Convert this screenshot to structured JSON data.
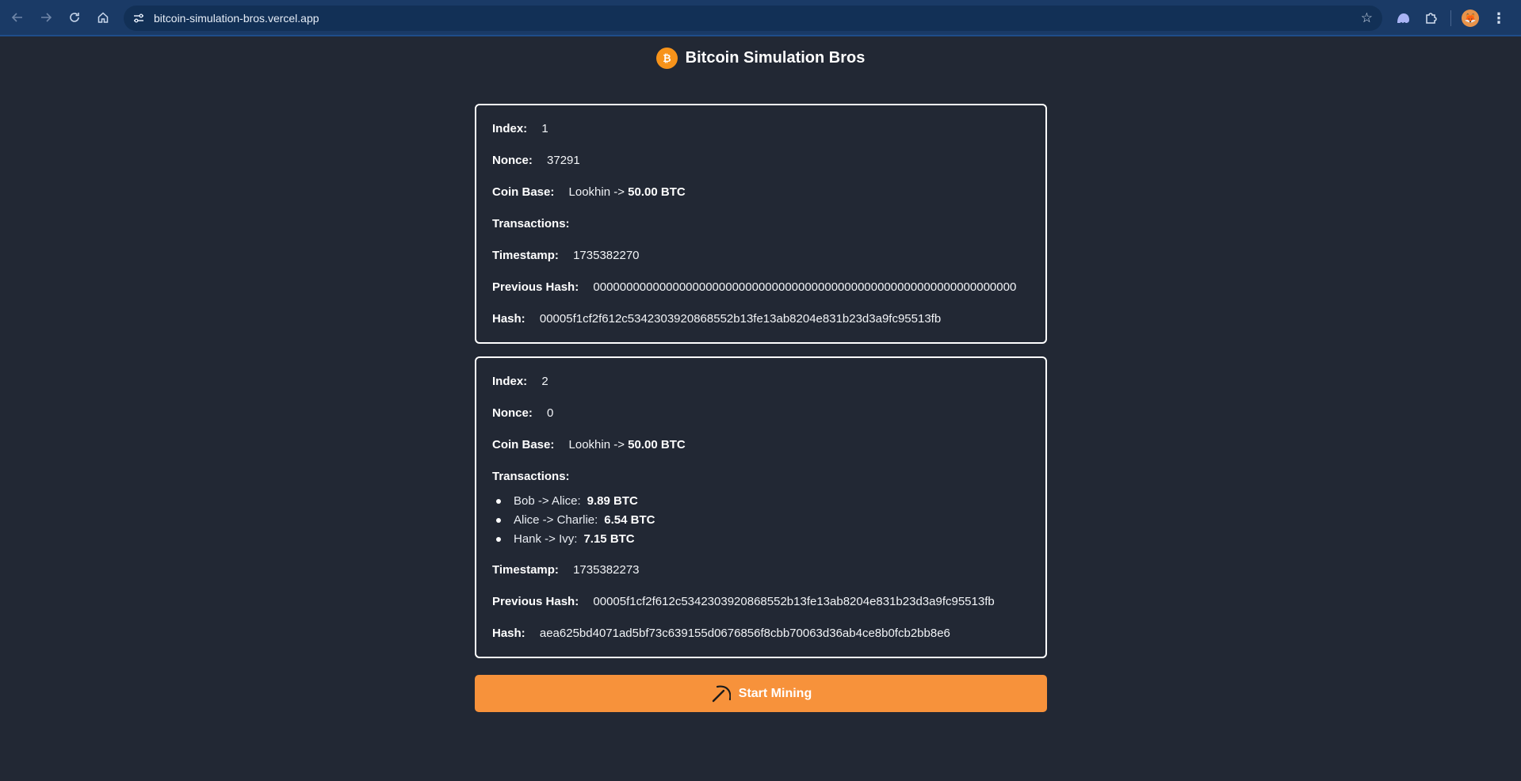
{
  "browser": {
    "url": "bitcoin-simulation-bros.vercel.app"
  },
  "header": {
    "title": "Bitcoin Simulation Bros",
    "logo_icon": "bitcoin-logo-icon",
    "logo_color": "#f7931a"
  },
  "labels": {
    "index": "Index:",
    "nonce": "Nonce:",
    "coinbase": "Coin Base:",
    "transactions": "Transactions:",
    "timestamp": "Timestamp:",
    "previous_hash": "Previous Hash:",
    "hash": "Hash:"
  },
  "blocks": [
    {
      "index": "1",
      "nonce": "37291",
      "coinbase_recipient": "Lookhin ->",
      "coinbase_amount": "50.00 BTC",
      "transactions": [],
      "timestamp": "1735382270",
      "previous_hash": "0000000000000000000000000000000000000000000000000000000000000000",
      "hash": "00005f1cf2f612c5342303920868552b13fe13ab8204e831b23d3a9fc95513fb"
    },
    {
      "index": "2",
      "nonce": "0",
      "coinbase_recipient": "Lookhin ->",
      "coinbase_amount": "50.00 BTC",
      "transactions": [
        {
          "parties": "Bob -> Alice:",
          "amount": "9.89 BTC"
        },
        {
          "parties": "Alice -> Charlie:",
          "amount": "6.54 BTC"
        },
        {
          "parties": "Hank -> Ivy:",
          "amount": "7.15 BTC"
        }
      ],
      "timestamp": "1735382273",
      "previous_hash": "00005f1cf2f612c5342303920868552b13fe13ab8204e831b23d3a9fc95513fb",
      "hash": "aea625bd4071ad5bf73c639155d0676856f8cbb70063d36ab4ce8b0fcb2bb8e6"
    }
  ],
  "actions": {
    "mine_label": "Start Mining",
    "mine_icon": "pickaxe-icon",
    "mine_color": "#f7923b"
  }
}
